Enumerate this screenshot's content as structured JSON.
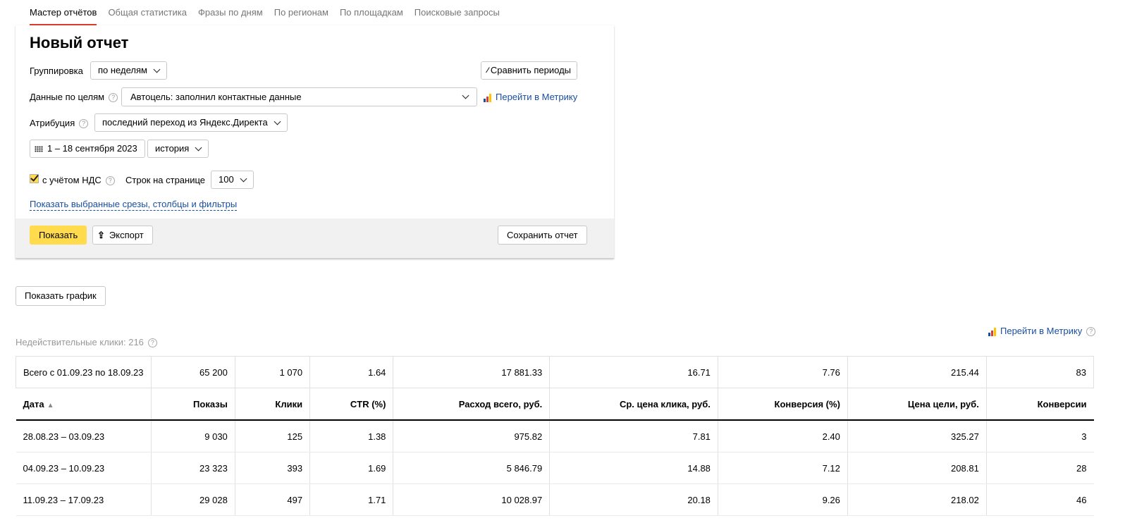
{
  "tabs": [
    {
      "label": "Мастер отчётов",
      "active": true
    },
    {
      "label": "Общая статистика"
    },
    {
      "label": "Фразы по дням"
    },
    {
      "label": "По регионам"
    },
    {
      "label": "По площадкам"
    },
    {
      "label": "Поисковые запросы"
    }
  ],
  "report": {
    "title": "Новый отчет",
    "grouping_label": "Группировка",
    "grouping_value": "по неделям",
    "compare_button": "Сравнить периоды",
    "goals_label": "Данные по целям",
    "goals_value": "Автоцель: заполнил контактные данные",
    "metrika_link": "Перейти в Метрику",
    "attribution_label": "Атрибуция",
    "attribution_value": "последний переход из Яндекс.Директа",
    "date_range": "1 – 18 сентября 2023",
    "history_value": "история",
    "vat_label": "с учётом НДС",
    "vat_checked": true,
    "rows_label": "Строк на странице",
    "rows_value": "100",
    "show_filters_link": "Показать выбранные срезы, столбцы и фильтры",
    "show_button": "Показать",
    "export_button": "Экспорт",
    "save_button": "Сохранить отчет"
  },
  "show_chart_button": "Показать график",
  "invalid_clicks": "Недействительные клики: 216",
  "metrika_link2": "Перейти в Метрику",
  "table": {
    "total": [
      "Всего с 01.09.23 по 18.09.23",
      "65 200",
      "1 070",
      "1.64",
      "17 881.33",
      "16.71",
      "7.76",
      "215.44",
      "83"
    ],
    "headers": [
      "Дата",
      "Показы",
      "Клики",
      "CTR (%)",
      "Расход всего, руб.",
      "Ср. цена клика, руб.",
      "Конверсия (%)",
      "Цена цели, руб.",
      "Конверсии"
    ],
    "rows": [
      [
        "28.08.23 – 03.09.23",
        "9 030",
        "125",
        "1.38",
        "975.82",
        "7.81",
        "2.40",
        "325.27",
        "3"
      ],
      [
        "04.09.23 – 10.09.23",
        "23 323",
        "393",
        "1.69",
        "5 846.79",
        "14.88",
        "7.12",
        "208.81",
        "28"
      ],
      [
        "11.09.23 – 17.09.23",
        "29 028",
        "497",
        "1.71",
        "10 028.97",
        "20.18",
        "9.26",
        "218.02",
        "46"
      ]
    ]
  },
  "colors": {
    "accent_yellow": "#ffdb4d",
    "tab_underline": "#e03b2c",
    "link": "#1a4ea0"
  }
}
